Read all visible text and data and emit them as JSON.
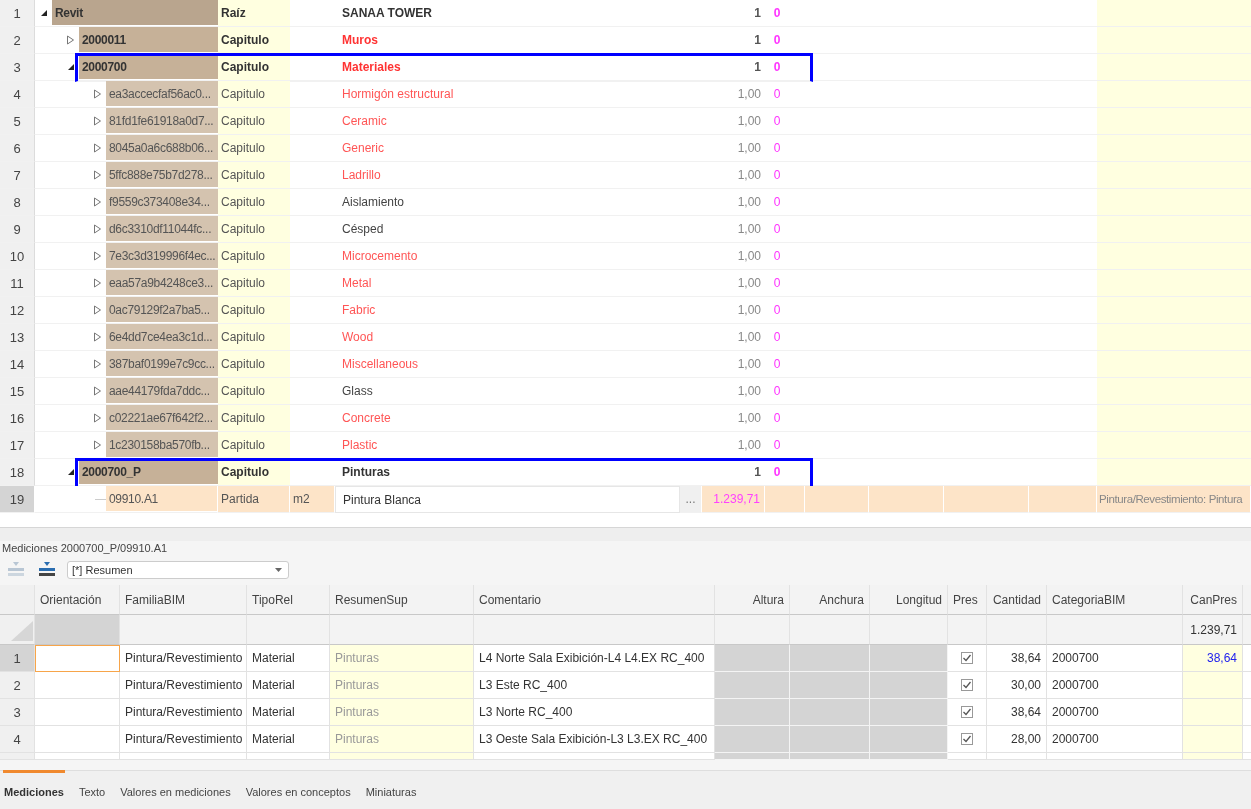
{
  "tree": {
    "rows": [
      {
        "number": "1",
        "kind": "root",
        "code": "Revit",
        "type": "Raíz",
        "summary": "SANAA TOWER",
        "color": "#333333",
        "quantity": "1",
        "count": "0",
        "expanded": true,
        "outlined": false,
        "selected": false,
        "children": [
          {
            "number": "2",
            "kind": "chapter",
            "code": "2000011",
            "type": "Capitulo",
            "summary": "Muros",
            "color": "#ff3333",
            "quantity": "1",
            "count": "0",
            "expanded": false,
            "outlined": false,
            "selected": false
          },
          {
            "number": "3",
            "kind": "chapter",
            "code": "2000700",
            "type": "Capitulo",
            "summary": "Materiales",
            "color": "#ff3333",
            "quantity": "1",
            "count": "0",
            "expanded": true,
            "outlined": true,
            "selected": false,
            "children": [
              {
                "number": "4",
                "kind": "subchapter",
                "code": "ea3accecfaf56ac0...",
                "type": "Capitulo",
                "summary": "Hormigón estructural",
                "color": "#ff5555",
                "quantity": "1,00",
                "count": "0",
                "expanded": false,
                "outlined": false,
                "selected": false
              },
              {
                "number": "5",
                "kind": "subchapter",
                "code": "81fd1fe61918a0d7...",
                "type": "Capitulo",
                "summary": "Ceramic",
                "color": "#ff5555",
                "quantity": "1,00",
                "count": "0",
                "expanded": false,
                "outlined": false,
                "selected": false
              },
              {
                "number": "6",
                "kind": "subchapter",
                "code": "8045a0a6c688b06...",
                "type": "Capitulo",
                "summary": "Generic",
                "color": "#ff5555",
                "quantity": "1,00",
                "count": "0",
                "expanded": false,
                "outlined": false,
                "selected": false
              },
              {
                "number": "7",
                "kind": "subchapter",
                "code": "5ffc888e75b7d278...",
                "type": "Capitulo",
                "summary": "Ladrillo",
                "color": "#ff5555",
                "quantity": "1,00",
                "count": "0",
                "expanded": false,
                "outlined": false,
                "selected": false
              },
              {
                "number": "8",
                "kind": "subchapter",
                "code": "f9559c373408e34...",
                "type": "Capitulo",
                "summary": "Aislamiento",
                "color": "#444444",
                "quantity": "1,00",
                "count": "0",
                "expanded": false,
                "outlined": false,
                "selected": false
              },
              {
                "number": "9",
                "kind": "subchapter",
                "code": "d6c3310df11044fc...",
                "type": "Capitulo",
                "summary": "Césped",
                "color": "#444444",
                "quantity": "1,00",
                "count": "0",
                "expanded": false,
                "outlined": false,
                "selected": false
              },
              {
                "number": "10",
                "kind": "subchapter",
                "code": "7e3c3d319996f4ec...",
                "type": "Capitulo",
                "summary": "Microcemento",
                "color": "#ff5555",
                "quantity": "1,00",
                "count": "0",
                "expanded": false,
                "outlined": false,
                "selected": false
              },
              {
                "number": "11",
                "kind": "subchapter",
                "code": "eaa57a9b4248ce3...",
                "type": "Capitulo",
                "summary": "Metal",
                "color": "#ff5555",
                "quantity": "1,00",
                "count": "0",
                "expanded": false,
                "outlined": false,
                "selected": false
              },
              {
                "number": "12",
                "kind": "subchapter",
                "code": "0ac79129f2a7ba5...",
                "type": "Capitulo",
                "summary": "Fabric",
                "color": "#ff5555",
                "quantity": "1,00",
                "count": "0",
                "expanded": false,
                "outlined": false,
                "selected": false
              },
              {
                "number": "13",
                "kind": "subchapter",
                "code": "6e4dd7ce4ea3c1d...",
                "type": "Capitulo",
                "summary": "Wood",
                "color": "#ff5555",
                "quantity": "1,00",
                "count": "0",
                "expanded": false,
                "outlined": false,
                "selected": false
              },
              {
                "number": "14",
                "kind": "subchapter",
                "code": "387baf0199e7c9cc...",
                "type": "Capitulo",
                "summary": "Miscellaneous",
                "color": "#ff5555",
                "quantity": "1,00",
                "count": "0",
                "expanded": false,
                "outlined": false,
                "selected": false
              },
              {
                "number": "15",
                "kind": "subchapter",
                "code": "aae44179fda7ddc...",
                "type": "Capitulo",
                "summary": "Glass",
                "color": "#444444",
                "quantity": "1,00",
                "count": "0",
                "expanded": false,
                "outlined": false,
                "selected": false
              },
              {
                "number": "16",
                "kind": "subchapter",
                "code": "c02221ae67f642f2...",
                "type": "Capitulo",
                "summary": "Concrete",
                "color": "#ff5555",
                "quantity": "1,00",
                "count": "0",
                "expanded": false,
                "outlined": false,
                "selected": false
              },
              {
                "number": "17",
                "kind": "subchapter",
                "code": "1c230158ba570fb...",
                "type": "Capitulo",
                "summary": "Plastic",
                "color": "#ff5555",
                "quantity": "1,00",
                "count": "0",
                "expanded": false,
                "outlined": false,
                "selected": false
              }
            ]
          },
          {
            "number": "18",
            "kind": "chapter",
            "code": "2000700_P",
            "type": "Capitulo",
            "summary": "Pinturas",
            "color": "#333333",
            "quantity": "1",
            "count": "0",
            "expanded": true,
            "outlined": true,
            "selected": false,
            "children": [
              {
                "number": "19",
                "kind": "item",
                "code": "09910.A1",
                "type": "Partida",
                "unit": "m2",
                "summary": "Pintura Blanca",
                "color": "#333333",
                "button": "...",
                "quantity": "1.239,71",
                "note": "Pintura/Revestimiento: Pintura",
                "outlined": false,
                "selected": true
              }
            ]
          }
        ]
      }
    ]
  },
  "measurements": {
    "title": "Mediciones 2000700_P/09910.A1",
    "toolbar": {
      "buttons": [
        {
          "disabled": true
        },
        {
          "disabled": false
        }
      ],
      "dropdown": "[*] Resumen"
    },
    "columns": [
      {
        "label": "Orientación"
      },
      {
        "label": "FamiliaBIM"
      },
      {
        "label": "TipoRel"
      },
      {
        "label": "ResumenSup"
      },
      {
        "label": "Comentario"
      },
      {
        "label": "Altura"
      },
      {
        "label": "Anchura"
      },
      {
        "label": "Longitud"
      },
      {
        "label": "Pres"
      },
      {
        "label": "Cantidad"
      },
      {
        "label": "CategoriaBIM"
      },
      {
        "label": "CanPres",
        "total": "1.239,71"
      }
    ],
    "rows": [
      {
        "number": "1",
        "selected": true,
        "focused": true,
        "familia": "Pintura/Revestimiento",
        "tipo": "Material",
        "resumen": "Pinturas",
        "comentario": "L4 Norte Sala Exibición-L4 L4.EX RC_400",
        "pres": true,
        "cantidad": "38,64",
        "categoria": "2000700",
        "canpres": "38,64"
      },
      {
        "number": "2",
        "selected": false,
        "focused": false,
        "familia": "Pintura/Revestimiento",
        "tipo": "Material",
        "resumen": "Pinturas",
        "comentario": "L3 Este RC_400",
        "pres": true,
        "cantidad": "30,00",
        "categoria": "2000700"
      },
      {
        "number": "3",
        "selected": false,
        "focused": false,
        "familia": "Pintura/Revestimiento",
        "tipo": "Material",
        "resumen": "Pinturas",
        "comentario": "L3 Norte RC_400",
        "pres": true,
        "cantidad": "38,64",
        "categoria": "2000700"
      },
      {
        "number": "4",
        "selected": false,
        "focused": false,
        "familia": "Pintura/Revestimiento",
        "tipo": "Material",
        "resumen": "Pinturas",
        "comentario": "L3 Oeste Sala Exibición-L3 L3.EX RC_400",
        "pres": true,
        "cantidad": "28,00",
        "categoria": "2000700"
      }
    ]
  },
  "tabs": [
    {
      "label": "Mediciones",
      "selected": true
    },
    {
      "label": "Texto",
      "selected": false
    },
    {
      "label": "Valores en mediciones",
      "selected": false
    },
    {
      "label": "Valores en conceptos",
      "selected": false
    },
    {
      "label": "Miniaturas",
      "selected": false
    }
  ]
}
